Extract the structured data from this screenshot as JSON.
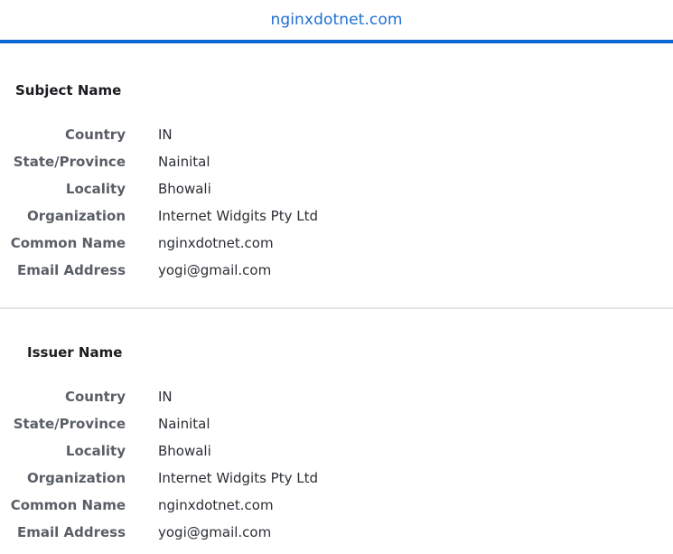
{
  "header": {
    "title": "nginxdotnet.com",
    "accent_color": "#0a66d0",
    "title_color": "#1f6fd0"
  },
  "sections": [
    {
      "heading": "Subject Name",
      "fields": [
        {
          "label": "Country",
          "value": "IN"
        },
        {
          "label": "State/Province",
          "value": "Nainital"
        },
        {
          "label": "Locality",
          "value": "Bhowali"
        },
        {
          "label": "Organization",
          "value": "Internet Widgits Pty Ltd"
        },
        {
          "label": "Common Name",
          "value": "nginxdotnet.com"
        },
        {
          "label": "Email Address",
          "value": "yogi@gmail.com"
        }
      ]
    },
    {
      "heading": "Issuer Name",
      "fields": [
        {
          "label": "Country",
          "value": "IN"
        },
        {
          "label": "State/Province",
          "value": "Nainital"
        },
        {
          "label": "Locality",
          "value": "Bhowali"
        },
        {
          "label": "Organization",
          "value": "Internet Widgits Pty Ltd"
        },
        {
          "label": "Common Name",
          "value": "nginxdotnet.com"
        },
        {
          "label": "Email Address",
          "value": "yogi@gmail.com"
        }
      ]
    }
  ]
}
